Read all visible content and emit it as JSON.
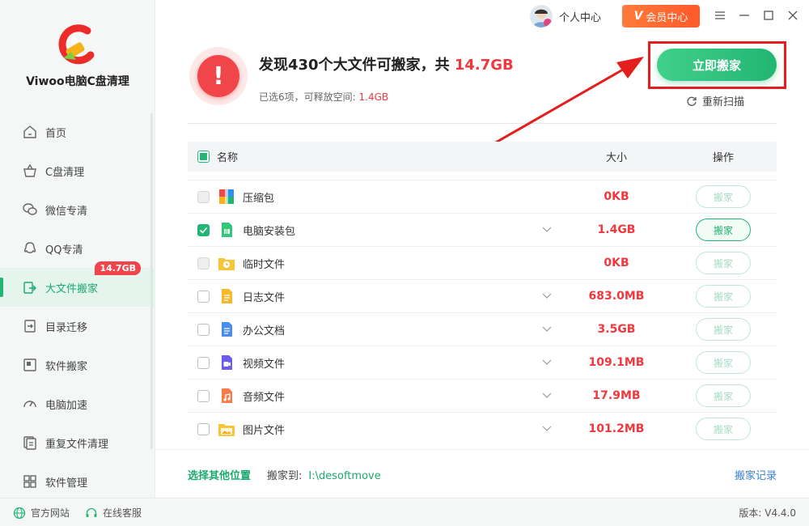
{
  "app": {
    "name": "Viwoo电脑C盘清理"
  },
  "titlebar": {
    "user_label": "个人中心",
    "vip_label": "会员中心",
    "vip_mark": "V"
  },
  "sidebar": {
    "items": [
      {
        "label": "首页",
        "icon": "home-icon"
      },
      {
        "label": "C盘清理",
        "icon": "basket-icon"
      },
      {
        "label": "微信专清",
        "icon": "wechat-icon"
      },
      {
        "label": "QQ专清",
        "icon": "qq-icon"
      },
      {
        "label": "大文件搬家",
        "icon": "move-file-icon",
        "active": true,
        "badge": "14.7GB"
      },
      {
        "label": "目录迁移",
        "icon": "folder-migrate-icon"
      },
      {
        "label": "软件搬家",
        "icon": "software-move-icon"
      },
      {
        "label": "电脑加速",
        "icon": "speedometer-icon"
      },
      {
        "label": "重复文件清理",
        "icon": "duplicate-file-icon"
      },
      {
        "label": "软件管理",
        "icon": "apps-grid-icon"
      }
    ]
  },
  "summary": {
    "headline_prefix": "发现430个大文件可搬家，共 ",
    "headline_size": "14.7GB",
    "subline_prefix": "已选6项，可释放空间: ",
    "subline_size": "1.4GB",
    "move_now_label": "立即搬家",
    "rescan_label": "重新扫描"
  },
  "table": {
    "headers": {
      "name": "名称",
      "size": "大小",
      "action": "操作"
    },
    "rows": [
      {
        "name": "压缩包",
        "size": "0KB",
        "action": "搬家",
        "checked": "disabled",
        "expand": false,
        "icon": "archive-icon"
      },
      {
        "name": "电脑安装包",
        "size": "1.4GB",
        "action": "搬家",
        "checked": "on",
        "expand": true,
        "icon": "installer-icon"
      },
      {
        "name": "临时文件",
        "size": "0KB",
        "action": "搬家",
        "checked": "disabled",
        "expand": false,
        "icon": "temp-folder-icon"
      },
      {
        "name": "日志文件",
        "size": "683.0MB",
        "action": "搬家",
        "checked": "off",
        "expand": true,
        "icon": "log-file-icon"
      },
      {
        "name": "办公文档",
        "size": "3.5GB",
        "action": "搬家",
        "checked": "off",
        "expand": true,
        "icon": "document-icon"
      },
      {
        "name": "视频文件",
        "size": "109.1MB",
        "action": "搬家",
        "checked": "off",
        "expand": true,
        "icon": "video-file-icon"
      },
      {
        "name": "音频文件",
        "size": "17.9MB",
        "action": "搬家",
        "checked": "off",
        "expand": true,
        "icon": "audio-file-icon"
      },
      {
        "name": "图片文件",
        "size": "101.2MB",
        "action": "搬家",
        "checked": "off",
        "expand": true,
        "icon": "image-file-icon"
      }
    ]
  },
  "footer": {
    "other_location": "选择其他位置",
    "move_to_label": "搬家到:",
    "move_to_path": "I:\\desoftmove",
    "history": "搬家记录"
  },
  "statusbar": {
    "website": "官方网站",
    "support": "在线客服",
    "version": "版本: V4.4.0"
  },
  "colors": {
    "accent": "#22b573",
    "danger": "#f0383e",
    "vip": "#ff6a2f",
    "link": "#3a7fd5"
  }
}
